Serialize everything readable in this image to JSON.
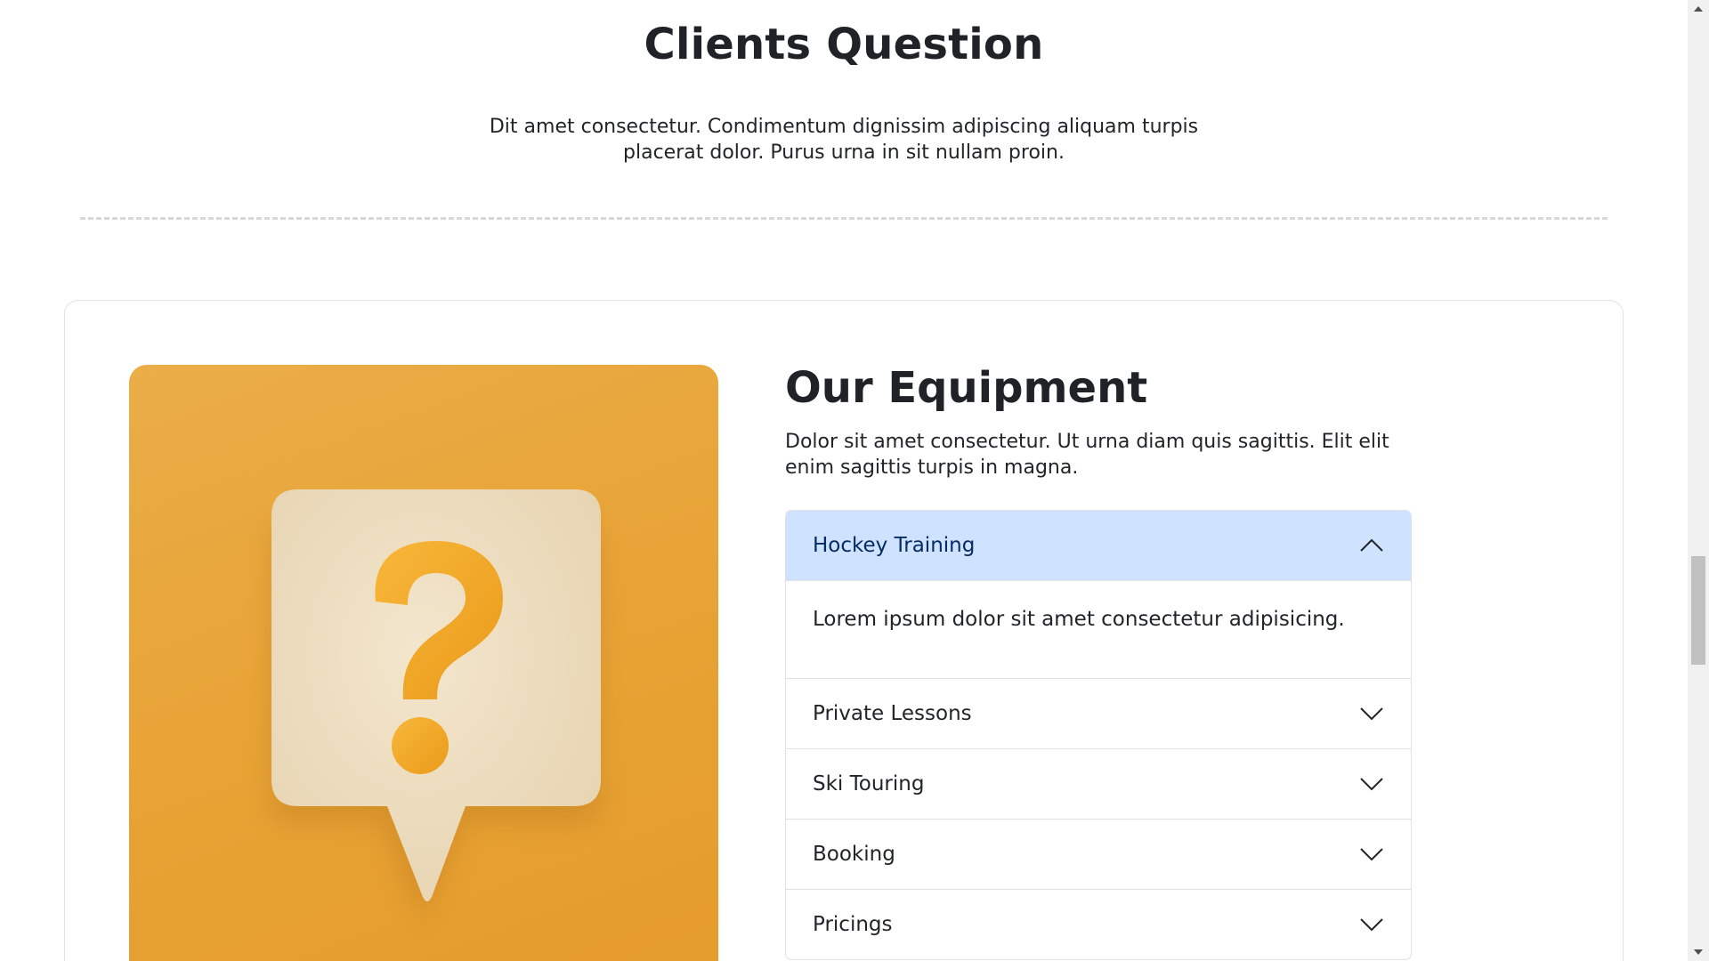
{
  "faq_section": {
    "title": "Clients Question",
    "description": "Dit amet consectetur. Condimentum dignissim adipiscing aliquam turpis placerat dolor. Purus urna in sit nullam proin."
  },
  "equipment": {
    "title": "Our Equipment",
    "description": "Dolor sit amet consectetur. Ut urna diam quis sagittis. Elit elit enim sagittis turpis in magna.",
    "illustration_icon": "question-speech-bubble-icon"
  },
  "accordion": {
    "items": [
      {
        "label": "Hockey Training",
        "expanded": true,
        "body": "Lorem ipsum dolor sit amet consectetur adipisicing."
      },
      {
        "label": "Private Lessons",
        "expanded": false
      },
      {
        "label": "Ski Touring",
        "expanded": false
      },
      {
        "label": "Booking",
        "expanded": false
      },
      {
        "label": "Pricings",
        "expanded": false
      }
    ]
  },
  "colors": {
    "accordion_active_bg": "#cfe2ff",
    "accordion_active_text": "#052c65",
    "illustration_bg": "#e8a437",
    "bubble": "#eedfc4",
    "question_mark": "#f2a526"
  }
}
